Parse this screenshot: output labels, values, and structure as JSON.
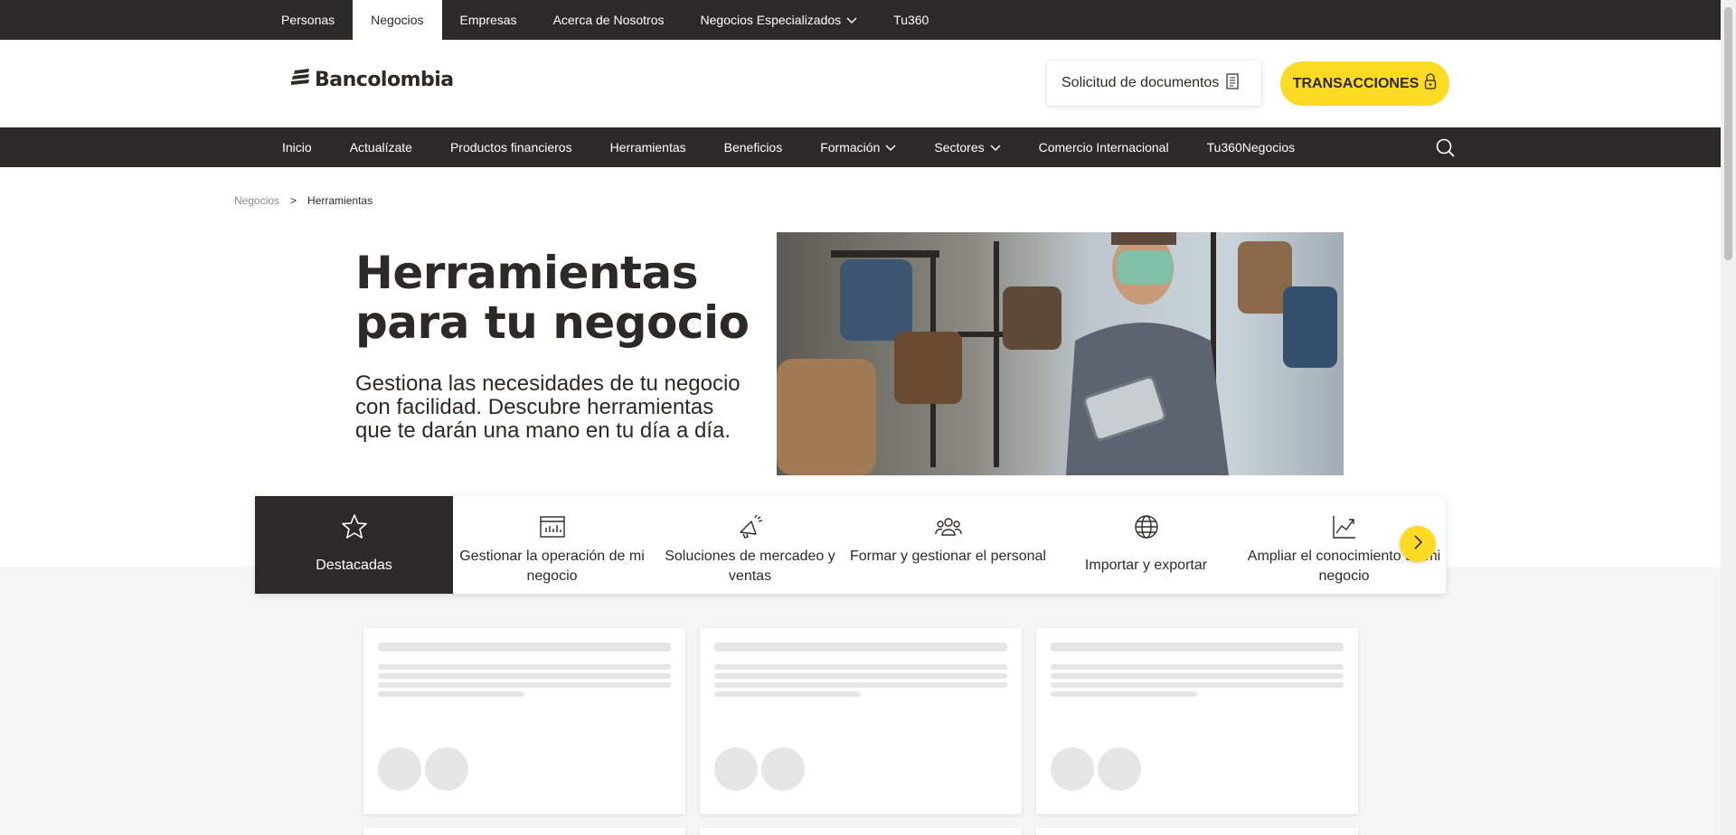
{
  "topbar": {
    "items": [
      {
        "label": "Personas"
      },
      {
        "label": "Negocios",
        "active": true
      },
      {
        "label": "Empresas"
      },
      {
        "label": "Acerca de Nosotros"
      },
      {
        "label": "Negocios Especializados",
        "has_dropdown": true
      },
      {
        "label": "Tu360"
      }
    ]
  },
  "header": {
    "logo_text": "Bancolombia",
    "docs_button": "Solicitud de documentos",
    "transactions_button": "TRANSACCIONES"
  },
  "mainnav": {
    "items": [
      {
        "label": "Inicio"
      },
      {
        "label": "Actualízate"
      },
      {
        "label": "Productos financieros"
      },
      {
        "label": "Herramientas"
      },
      {
        "label": "Beneficios"
      },
      {
        "label": "Formación",
        "has_dropdown": true
      },
      {
        "label": "Sectores",
        "has_dropdown": true
      },
      {
        "label": "Comercio Internacional"
      },
      {
        "label": "Tu360Negocios"
      }
    ],
    "search_icon": "search-icon"
  },
  "breadcrumb": {
    "items": [
      "Negocios",
      "Herramientas"
    ],
    "separator": ">"
  },
  "hero": {
    "title": "Herramientas para tu negocio",
    "subtitle": "Gestiona las necesidades de tu negocio con facilidad. Descubre herramientas que te darán una mano en tu día a día."
  },
  "categories": {
    "items": [
      {
        "label": "Destacadas",
        "icon": "star-icon",
        "active": true
      },
      {
        "label": "Gestionar la operación de mi negocio",
        "icon": "dashboard-icon"
      },
      {
        "label": "Soluciones de mercadeo y ventas",
        "icon": "megaphone-icon"
      },
      {
        "label": "Formar y gestionar el personal",
        "icon": "team-icon"
      },
      {
        "label": "Importar y exportar",
        "icon": "globe-icon"
      },
      {
        "label": "Ampliar el conocimiento de mi negocio",
        "icon": "growth-chart-icon"
      }
    ],
    "next_icon": "chevron-right-icon"
  },
  "colors": {
    "dark": "#2c2a29",
    "accent_yellow": "#fdda24",
    "skeleton": "#e6e6e6",
    "section_bg": "#f6f6f6"
  }
}
